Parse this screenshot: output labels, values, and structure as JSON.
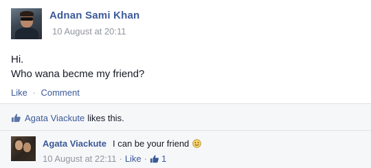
{
  "post": {
    "author": "Adnan Sami Khan",
    "timestamp": "10 August at 20:11",
    "line1": "Hi.",
    "line2": "Who wana becme my friend?",
    "like_label": "Like",
    "separator": "·",
    "comment_label": "Comment"
  },
  "likes": {
    "liker": "Agata Viackute",
    "text": "likes this."
  },
  "comment": {
    "author": "Agata Viackute",
    "text": "I can be your friend",
    "timestamp": "10 August at 22:11",
    "separator": "·",
    "like_label": "Like",
    "like_count": "1"
  },
  "colors": {
    "link": "#3b5998",
    "meta": "#90949c",
    "feedback_bg": "#f6f7f9"
  }
}
